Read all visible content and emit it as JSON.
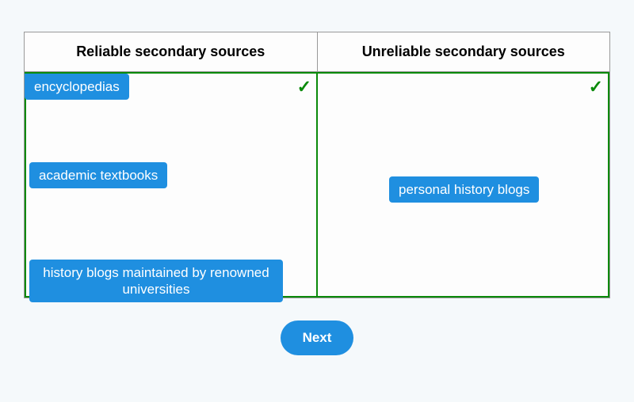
{
  "columns": {
    "left": {
      "header": "Reliable secondary sources",
      "correct": true,
      "items": [
        {
          "id": "encyclopedias",
          "label": "encyclopedias"
        },
        {
          "id": "academic",
          "label": "academic textbooks"
        },
        {
          "id": "historyblogs",
          "label": "history blogs maintained by renowned universities"
        }
      ]
    },
    "right": {
      "header": "Unreliable secondary sources",
      "correct": true,
      "items": [
        {
          "id": "personal",
          "label": "personal history blogs"
        }
      ]
    }
  },
  "buttons": {
    "next": "Next"
  },
  "glyphs": {
    "check": "✓"
  }
}
